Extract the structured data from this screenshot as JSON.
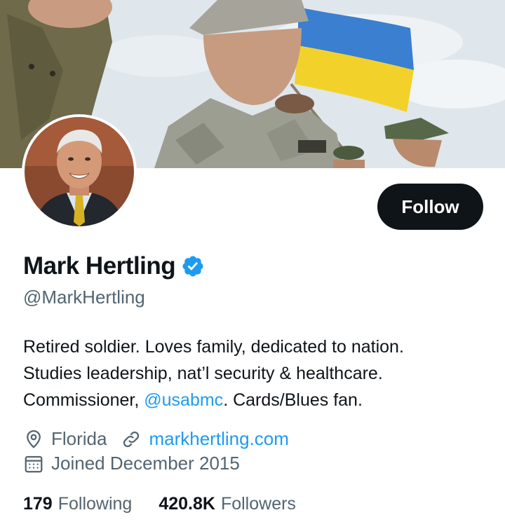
{
  "banner": {
    "alt_icon": "banner-photo"
  },
  "profile": {
    "display_name": "Mark Hertling",
    "handle": "@MarkHertling",
    "verified": true,
    "bio_line1": "Retired soldier. Loves family, dedicated to nation.",
    "bio_line2": "Studies leadership, nat’l security & healthcare.",
    "bio_line3_prefix": "Commissioner, ",
    "bio_mention": "@usabmc",
    "bio_line3_suffix": ". Cards/Blues fan.",
    "location": "Florida",
    "website": "markhertling.com",
    "joined": "Joined December 2015"
  },
  "actions": {
    "follow_label": "Follow"
  },
  "stats": {
    "following_count": "179",
    "following_label": "Following",
    "followers_count": "420.8K",
    "followers_label": "Followers"
  },
  "colors": {
    "accent": "#1d9bf0",
    "text_primary": "#0f1419",
    "text_secondary": "#536471",
    "button_bg": "#0f1419"
  },
  "icons": [
    "location-pin-icon",
    "link-icon",
    "calendar-icon",
    "verified-badge-icon"
  ]
}
